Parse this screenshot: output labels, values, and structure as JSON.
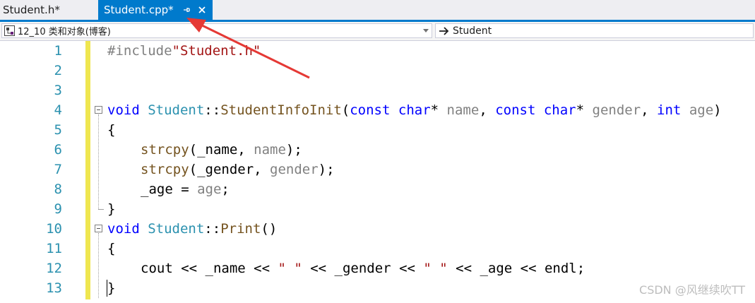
{
  "tabs": [
    {
      "label": "Student.h*",
      "active": false
    },
    {
      "label": "Student.cpp*",
      "active": true
    }
  ],
  "tab_icons": {
    "pin": "pin-icon",
    "close": "close-icon"
  },
  "navbar": {
    "project": "12_10 类和对象(博客)",
    "scope": "Student"
  },
  "line_numbers": [
    "1",
    "2",
    "3",
    "4",
    "5",
    "6",
    "7",
    "8",
    "9",
    "10",
    "11",
    "12",
    "13"
  ],
  "code": {
    "l1": {
      "pp": "#include",
      "str": "\"Student.h\""
    },
    "l4": {
      "kw1": "void",
      "cls": "Student",
      "sep": "::",
      "fn": "StudentInfoInit",
      "open": "(",
      "k2": "const",
      "k3": "char",
      "star1": "* ",
      "p1": "name",
      "c1": ", ",
      "k4": "const",
      "k5": "char",
      "star2": "* ",
      "p2": "gender",
      "c2": ", ",
      "k6": "int",
      "sp": " ",
      "p3": "age",
      "close": ")"
    },
    "l5": "{",
    "l6": {
      "fn": "strcpy",
      "a": "(_name, ",
      "p": "name",
      "b": ");"
    },
    "l7": {
      "fn": "strcpy",
      "a": "(_gender, ",
      "p": "gender",
      "b": ");"
    },
    "l8": {
      "a": "_age = ",
      "p": "age",
      "b": ";"
    },
    "l9": "}",
    "l10": {
      "kw": "void",
      "cls": "Student",
      "sep": "::",
      "fn": "Print",
      "rest": "()"
    },
    "l11": "{",
    "l12": {
      "a": "cout << _name << ",
      "s1": "\" \"",
      "b": " << _gender << ",
      "s2": "\" \"",
      "c": " << _age << endl;"
    },
    "l13": "}"
  },
  "colors": {
    "accent": "#007acc",
    "keyword": "#0000ff",
    "type": "#2b91af",
    "string": "#a31515",
    "param": "#808080",
    "changebar": "#efe650",
    "arrow": "#e53935"
  },
  "watermark": "CSDN @风继续吹TT"
}
